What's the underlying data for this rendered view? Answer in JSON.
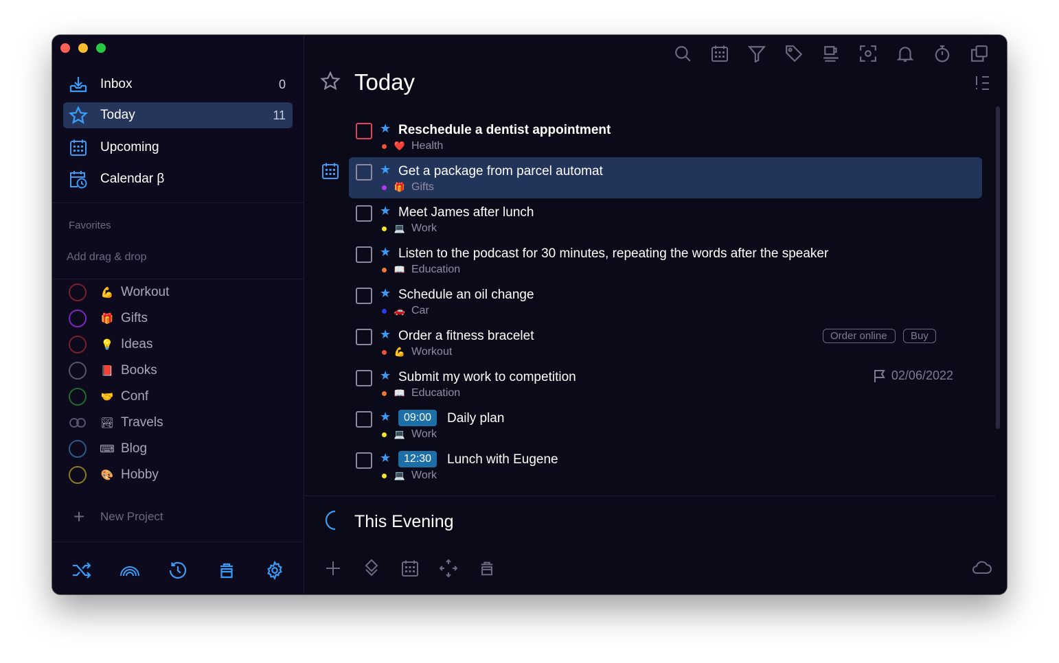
{
  "nav": {
    "inbox": {
      "label": "Inbox",
      "count": "0"
    },
    "today": {
      "label": "Today",
      "count": "11"
    },
    "upcoming": {
      "label": "Upcoming"
    },
    "calendar": {
      "label": "Calendar β"
    }
  },
  "favorites": {
    "title": "Favorites",
    "hint": "Add drag & drop"
  },
  "projects": [
    {
      "label": "Workout",
      "emoji": "💪",
      "ring_color": "#7a1f2c"
    },
    {
      "label": "Gifts",
      "emoji": "🎁",
      "ring_color": "#7a28c0"
    },
    {
      "label": "Ideas",
      "emoji": "💡",
      "ring_color": "#7a1f2c"
    },
    {
      "label": "Books",
      "emoji": "📕",
      "ring_color": "#55546a"
    },
    {
      "label": "Conf",
      "emoji": "🤝",
      "ring_color": "#1f6a2e"
    },
    {
      "label": "Travels",
      "emoji": "🏞",
      "ring_color": "#55546a"
    },
    {
      "label": "Blog",
      "emoji": "⌨",
      "ring_color": "#2a5b8a"
    },
    {
      "label": "Hobby",
      "emoji": "🎨",
      "ring_color": "#8a7a22"
    }
  ],
  "new_project": {
    "label": "New Project"
  },
  "header": {
    "title": "Today"
  },
  "tasks": [
    {
      "title": "Reschedule a dentist appointment",
      "project": "Health",
      "emoji": "❤️",
      "dot": "#f0523a"
    },
    {
      "title": "Get a package from parcel automat",
      "project": "Gifts",
      "emoji": "🎁",
      "dot": "#b537f2"
    },
    {
      "title": "Meet James after lunch",
      "project": "Work",
      "emoji": "💻",
      "dot": "#f5e52a"
    },
    {
      "title": "Listen to the podcast for 30 minutes, repeating the words after the speaker",
      "project": "Education",
      "emoji": "📖",
      "dot": "#f0753a"
    },
    {
      "title": "Schedule an oil change",
      "project": "Car",
      "emoji": "🚗",
      "dot": "#2a3cf0"
    },
    {
      "title": "Order a fitness bracelet",
      "project": "Workout",
      "emoji": "💪",
      "dot": "#f0523a",
      "tags": [
        "Order online",
        "Buy"
      ]
    },
    {
      "title": "Submit my work to competition",
      "project": "Education",
      "emoji": "📖",
      "dot": "#f0753a",
      "deadline": "02/06/2022"
    },
    {
      "title": "Daily plan",
      "time": "09:00",
      "project": "Work",
      "emoji": "💻",
      "dot": "#f5e52a"
    },
    {
      "title": "Lunch with Eugene",
      "time": "12:30",
      "project": "Work",
      "emoji": "💻",
      "dot": "#f5e52a"
    }
  ],
  "evening": {
    "title": "This Evening"
  },
  "colors": {
    "accent": "#3a9cf6",
    "selected_bg": "#25355c",
    "window_bg": "#0c0a1c"
  }
}
